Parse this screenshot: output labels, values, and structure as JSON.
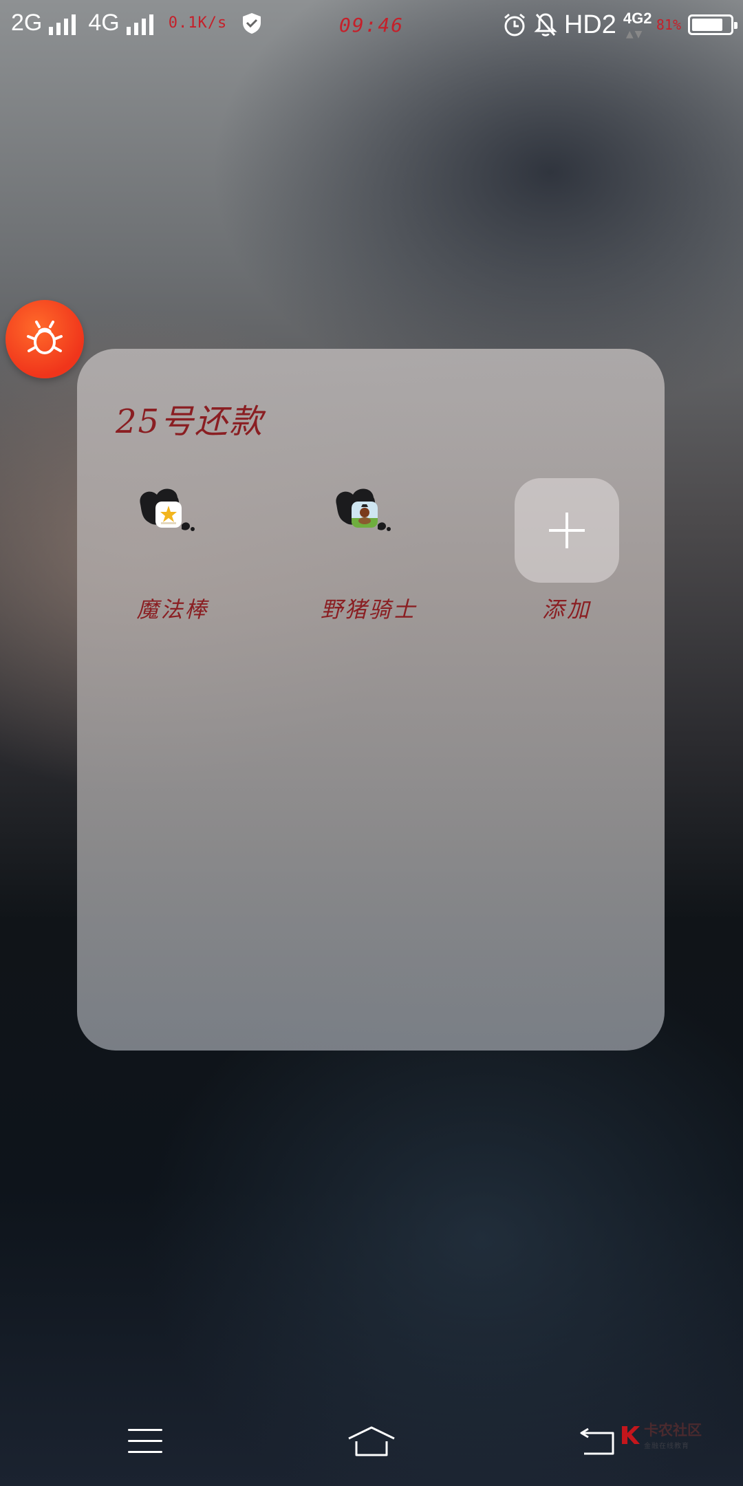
{
  "status_bar": {
    "sim1_label": "2G",
    "sim2_label": "4G",
    "net_speed": "0.1K/s",
    "time": "09:46",
    "hd_label": "HD2",
    "net_type": "4G2",
    "battery_percent_text": "81%",
    "battery_level": 0.81
  },
  "folder": {
    "title": "25号还款",
    "apps": [
      {
        "label": "魔法棒",
        "icon": "magic-wand-app-icon"
      },
      {
        "label": "野猪骑士",
        "icon": "boar-knight-app-icon"
      }
    ],
    "add_label": "添加"
  },
  "nav": {
    "menu_icon": "menu-icon",
    "home_icon": "home-icon",
    "back_icon": "back-icon"
  },
  "watermark": {
    "main": "卡农社区",
    "sub": "金融在线教育"
  }
}
